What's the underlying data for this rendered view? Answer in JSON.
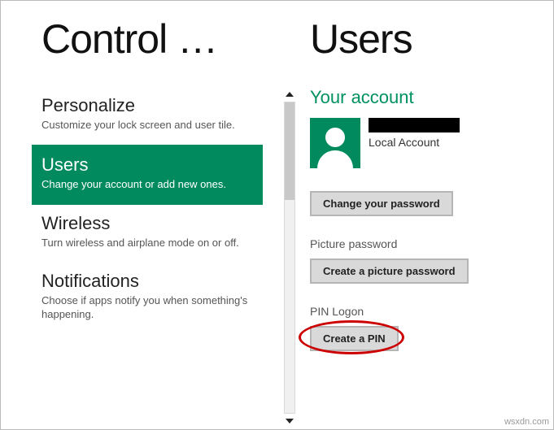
{
  "left": {
    "title": "Control …",
    "items": [
      {
        "title": "Personalize",
        "desc": "Customize your lock screen and user tile."
      },
      {
        "title": "Users",
        "desc": "Change your account or add new ones."
      },
      {
        "title": "Wireless",
        "desc": "Turn wireless and airplane mode on or off."
      },
      {
        "title": "Notifications",
        "desc": "Choose if apps notify you when something's happening."
      }
    ]
  },
  "right": {
    "title": "Users",
    "accountHeader": "Your account",
    "accountType": "Local Account",
    "changePassword": "Change your password",
    "picturePasswordLabel": "Picture password",
    "createPicturePassword": "Create a picture password",
    "pinLogonLabel": "PIN Logon",
    "createPin": "Create a PIN"
  },
  "watermark": "wsxdn.com"
}
